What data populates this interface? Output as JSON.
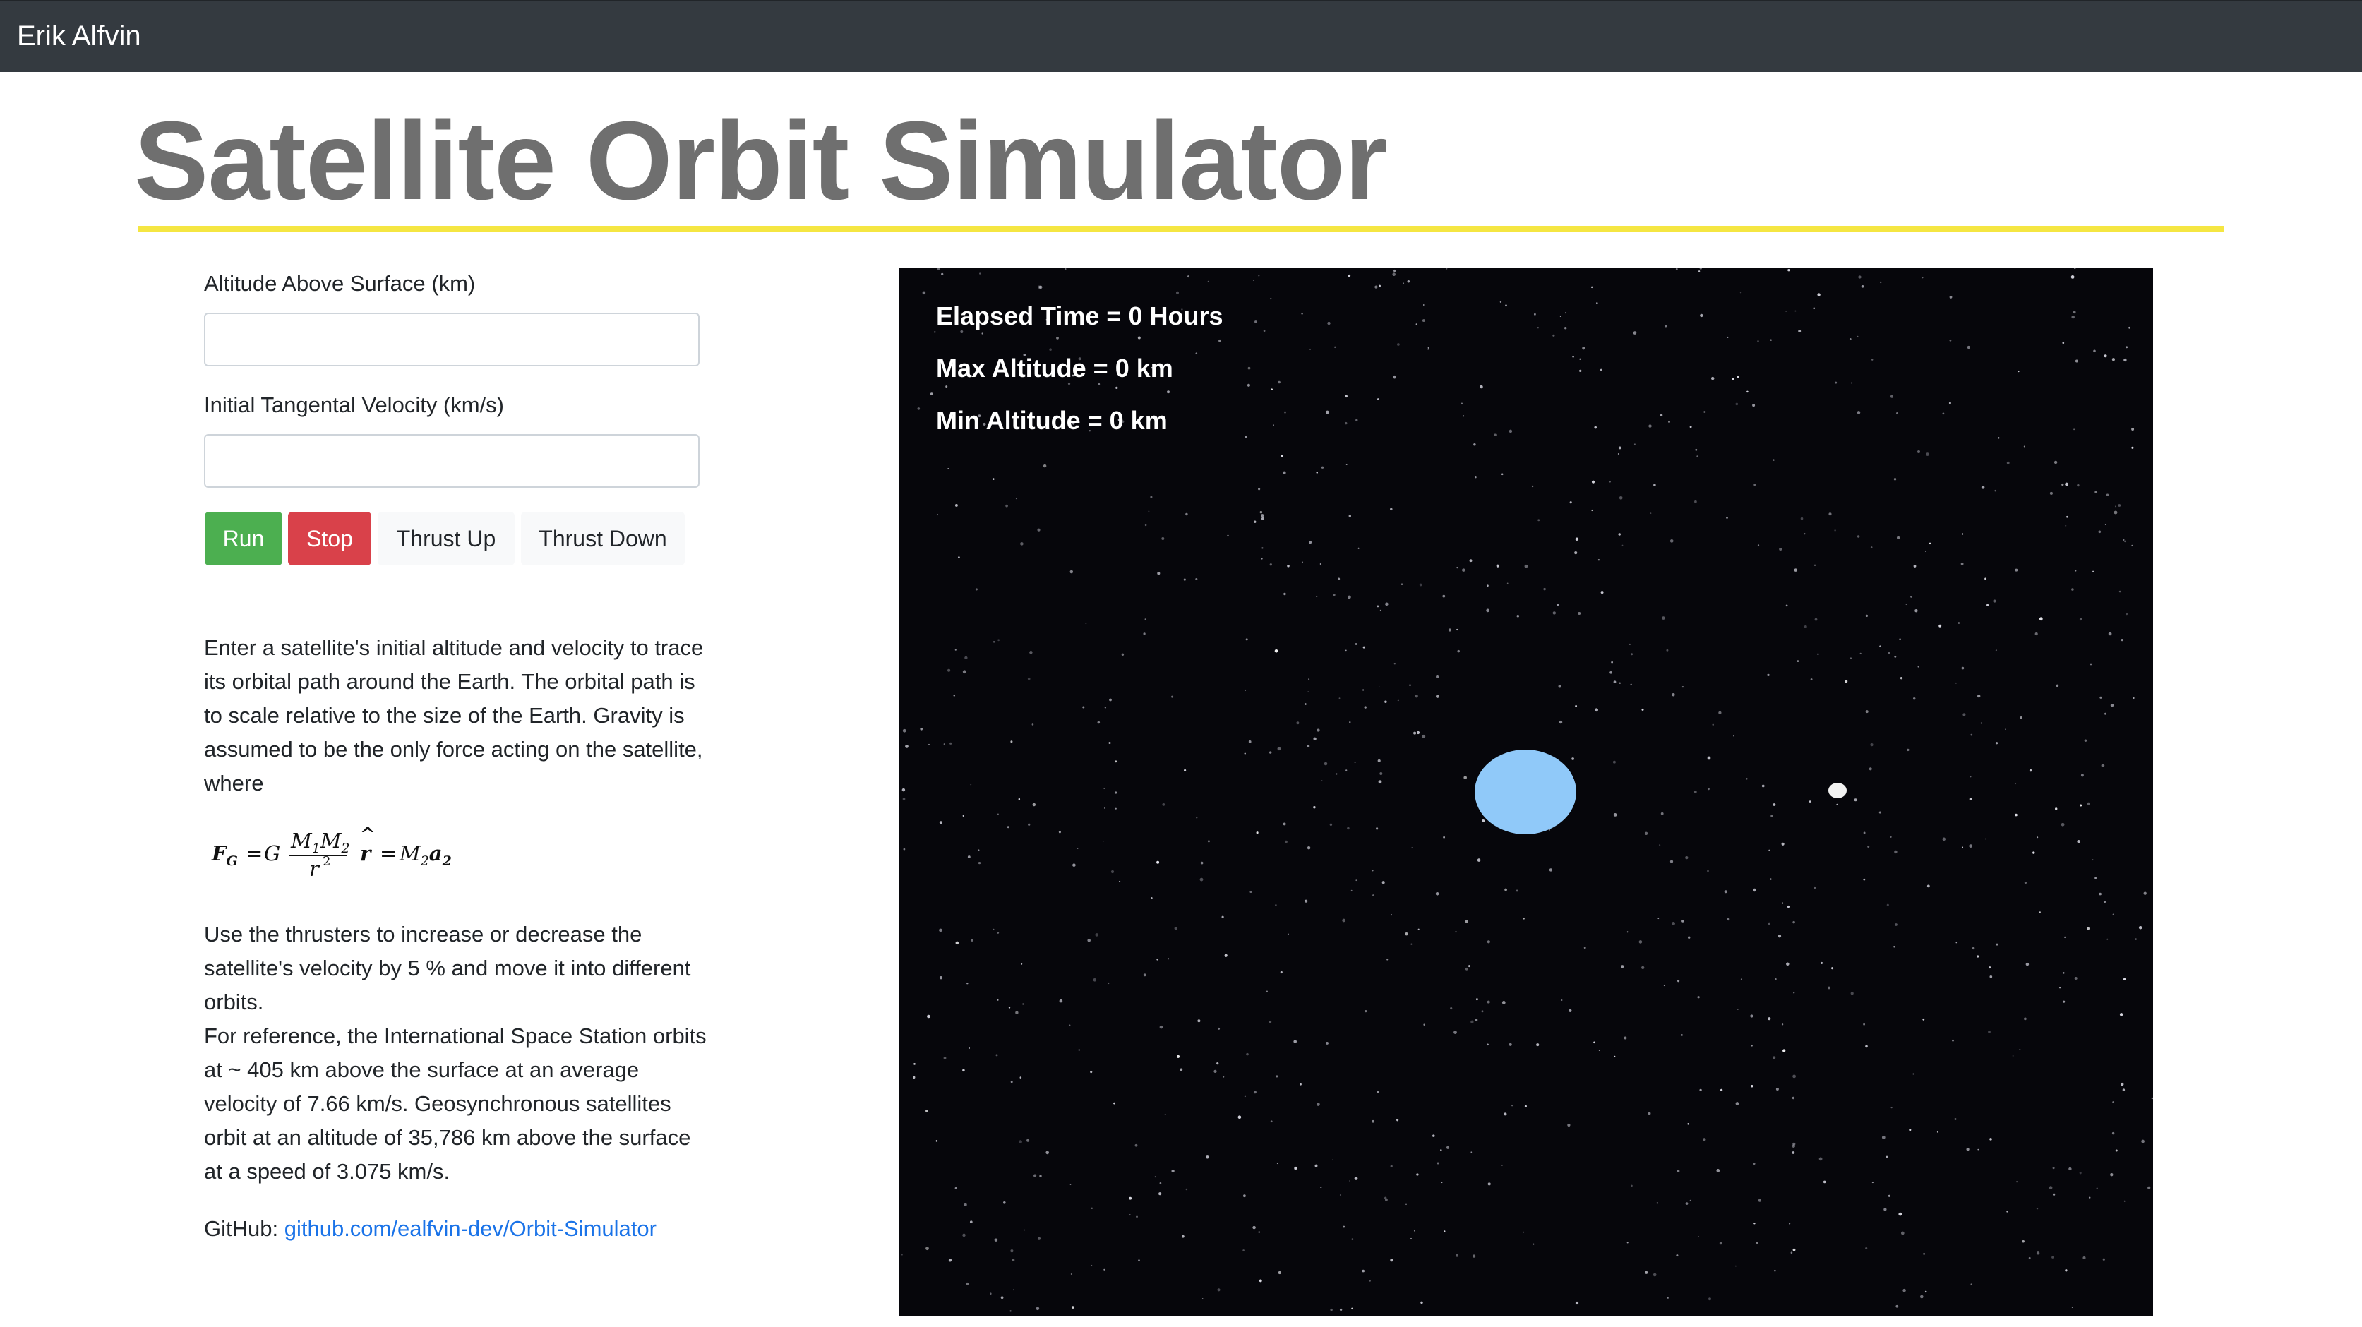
{
  "navbar": {
    "brand": "Erik Alfvin"
  },
  "page": {
    "title": "Satellite Orbit Simulator",
    "accent_color": "#f5e642"
  },
  "form": {
    "altitude_label": "Altitude Above Surface (km)",
    "altitude_value": "",
    "velocity_label": "Initial Tangental Velocity (km/s)",
    "velocity_value": ""
  },
  "buttons": {
    "run": "Run",
    "stop": "Stop",
    "thrust_up": "Thrust Up",
    "thrust_down": "Thrust Down",
    "run_color": "#4caf50",
    "stop_color": "#d9414a"
  },
  "description": {
    "intro": "Enter a satellite's initial altitude and velocity to trace its orbital path around the Earth. The orbital path is to scale relative to the size of the Earth. Gravity is assumed to be the only force acting on the satellite, where",
    "formula": {
      "lhs_f": "F",
      "lhs_sub": "G",
      "equals1": "=",
      "g": "G",
      "numerator": "M",
      "num_sub1": "1",
      "numerator2": "M",
      "num_sub2": "2",
      "denominator": "r",
      "denominator_exp": "2",
      "rhat": "r",
      "hat": "^",
      "equals2": "=",
      "rhs_m": "M",
      "rhs_m_sub": "2",
      "rhs_a": "a",
      "rhs_a_sub": "2"
    },
    "thrusters": "Use the thrusters to increase or decrease the satellite's velocity by 5 % and move it into different orbits.",
    "reference": "For reference, the International Space Station orbits at ~ 405 km above the surface at an average velocity of 7.66 km/s. Geosynchronous satellites orbit at an altitude of 35,786 km above the surface at a speed of 3.075 km/s."
  },
  "github": {
    "label": "GitHub:",
    "link_text": "github.com/ealfvin-dev/Orbit-Simulator"
  },
  "simulation": {
    "elapsed_time": "Elapsed Time = 0 Hours",
    "max_altitude": "Max Altitude = 0 km",
    "min_altitude": "Min Altitude = 0 km",
    "background_color": "#06060b",
    "earth_color": "#90c9f9",
    "satellite_color": "#f2f2f2"
  }
}
